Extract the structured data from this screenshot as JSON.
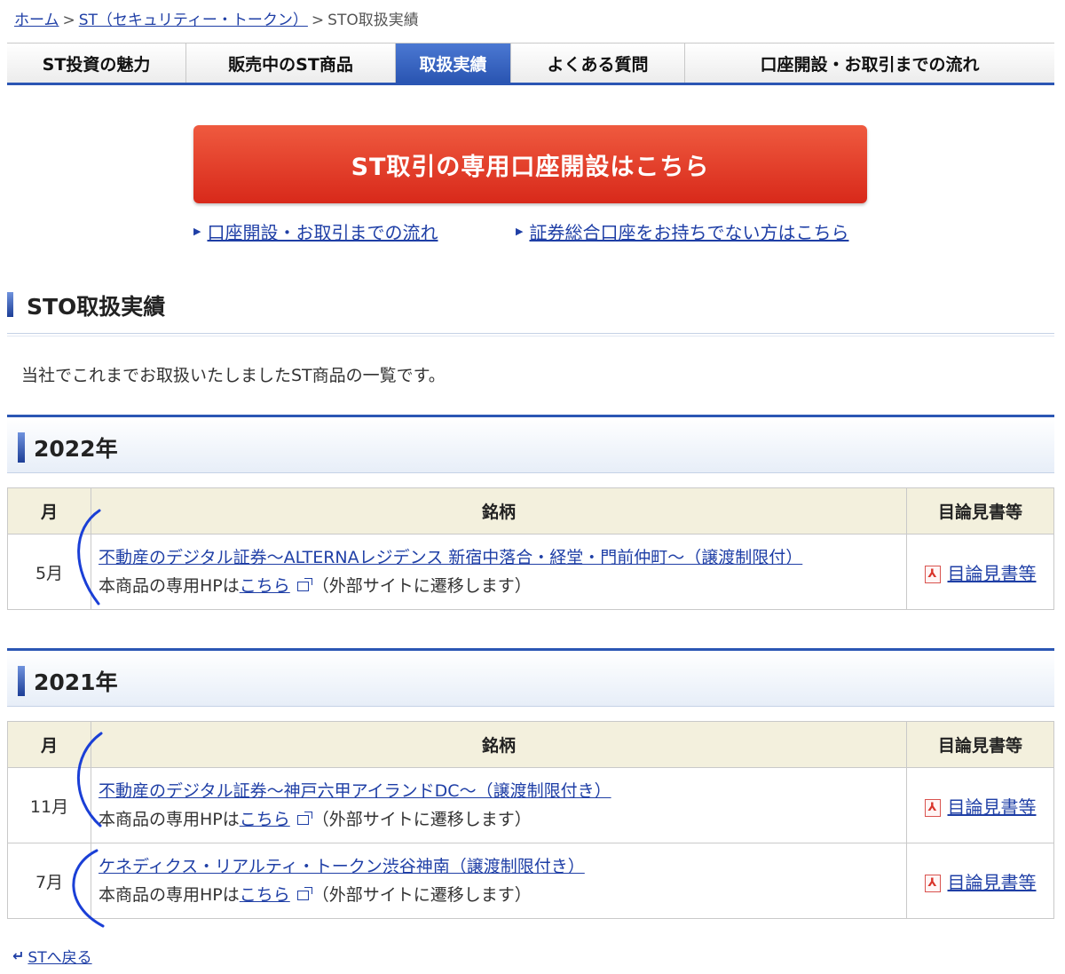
{
  "breadcrumb": {
    "home": "ホーム",
    "st": "ST（セキュリティー・トークン）",
    "current": "STO取扱実績",
    "sep": ">"
  },
  "tabs": [
    {
      "label": "ST投資の魅力"
    },
    {
      "label": "販売中のST商品"
    },
    {
      "label": "取扱実績"
    },
    {
      "label": "よくある質問"
    },
    {
      "label": "口座開設・お取引までの流れ"
    }
  ],
  "cta": {
    "label": "ST取引の専用口座開設はこちら"
  },
  "sublinks": [
    {
      "label": "口座開設・お取引までの流れ"
    },
    {
      "label": "証券総合口座をお持ちでない方はこちら"
    }
  ],
  "section": {
    "title": "STO取扱実績",
    "intro": "当社でこれまでお取扱いたしましたST商品の一覧です。"
  },
  "table_headers": {
    "month": "月",
    "name": "銘柄",
    "doc": "目論見書等"
  },
  "years": [
    {
      "year": "2022年",
      "rows": [
        {
          "month": "5月",
          "name": "不動産のデジタル証券～ALTERNAレジデンス 新宿中落合・経堂・門前仲町～（譲渡制限付）",
          "hp_prefix": "本商品の専用HPは",
          "hp_link": "こちら",
          "hp_suffix": "（外部サイトに遷移します）",
          "doc": "目論見書等"
        }
      ]
    },
    {
      "year": "2021年",
      "rows": [
        {
          "month": "11月",
          "name": "不動産のデジタル証券～神戸六甲アイランドDC～（譲渡制限付き）",
          "hp_prefix": "本商品の専用HPは",
          "hp_link": "こちら",
          "hp_suffix": "（外部サイトに遷移します）",
          "doc": "目論見書等"
        },
        {
          "month": "7月",
          "name": "ケネディクス・リアルティ・トークン渋谷神南（譲渡制限付き）",
          "hp_prefix": "本商品の専用HPは",
          "hp_link": "こちら",
          "hp_suffix": "（外部サイトに遷移します）",
          "doc": "目論見書等"
        }
      ]
    }
  ],
  "back": {
    "label": "STへ戻る"
  },
  "colors": {
    "accent_blue": "#2b56b4",
    "cta_red": "#e03a24",
    "link": "#1f3fa6",
    "header_beige": "#f3f0dd",
    "annotation": "#1a3fd6"
  },
  "icons": {
    "pdf": "pdf-icon",
    "external": "external-window-icon",
    "arrow": "triangle-right-icon",
    "return": "return-arrow-icon"
  }
}
